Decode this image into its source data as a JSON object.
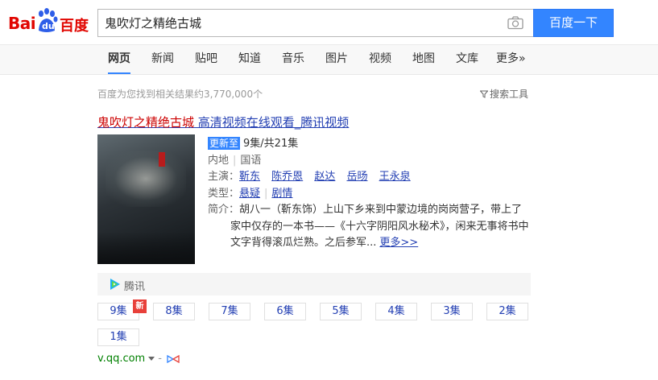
{
  "header": {
    "logo_text_left": "Bai",
    "logo_text_du": "du",
    "logo_text_right": "百度",
    "search_value": "鬼吹灯之精绝古城",
    "search_button": "百度一下"
  },
  "tabs": [
    {
      "label": "网页",
      "active": true
    },
    {
      "label": "新闻"
    },
    {
      "label": "贴吧"
    },
    {
      "label": "知道"
    },
    {
      "label": "音乐"
    },
    {
      "label": "图片"
    },
    {
      "label": "视频"
    },
    {
      "label": "地图"
    },
    {
      "label": "文库"
    },
    {
      "label": "更多»"
    }
  ],
  "results_info": {
    "count_text": "百度为您找到相关结果约3,770,000个",
    "tools_label": "搜索工具"
  },
  "result": {
    "title_em": "鬼吹灯之精绝古城",
    "title_rest": " 高清视频在线观看_腾讯视频",
    "update_badge": "更新至",
    "episodes_text": "9集/共21集",
    "region": "内地",
    "language": "国语",
    "cast_label": "主演：",
    "cast": [
      "靳东",
      "陈乔恩",
      "赵达",
      "岳旸",
      "王永泉"
    ],
    "genre_label": "类型：",
    "genres": [
      "悬疑",
      "剧情"
    ],
    "synopsis_label": "简介：",
    "synopsis": "胡八一（靳东饰）上山下乡来到中蒙边境的岗岗营子，带上了家中仅存的一本书——《十六字阴阳风水秘术》，闲来无事将书中文字背得滚瓜烂熟。之后参军...",
    "more_link": "更多>>",
    "source_name": "腾讯",
    "episodes": [
      "9集",
      "8集",
      "7集",
      "6集",
      "5集",
      "4集",
      "3集",
      "2集",
      "1集"
    ],
    "new_tag": "新",
    "url": "v.qq.com",
    "url_sep": "-"
  },
  "colors": {
    "accent": "#3385ff",
    "link": "#2440b3",
    "highlight": "#c00000",
    "url_green": "#008000"
  }
}
